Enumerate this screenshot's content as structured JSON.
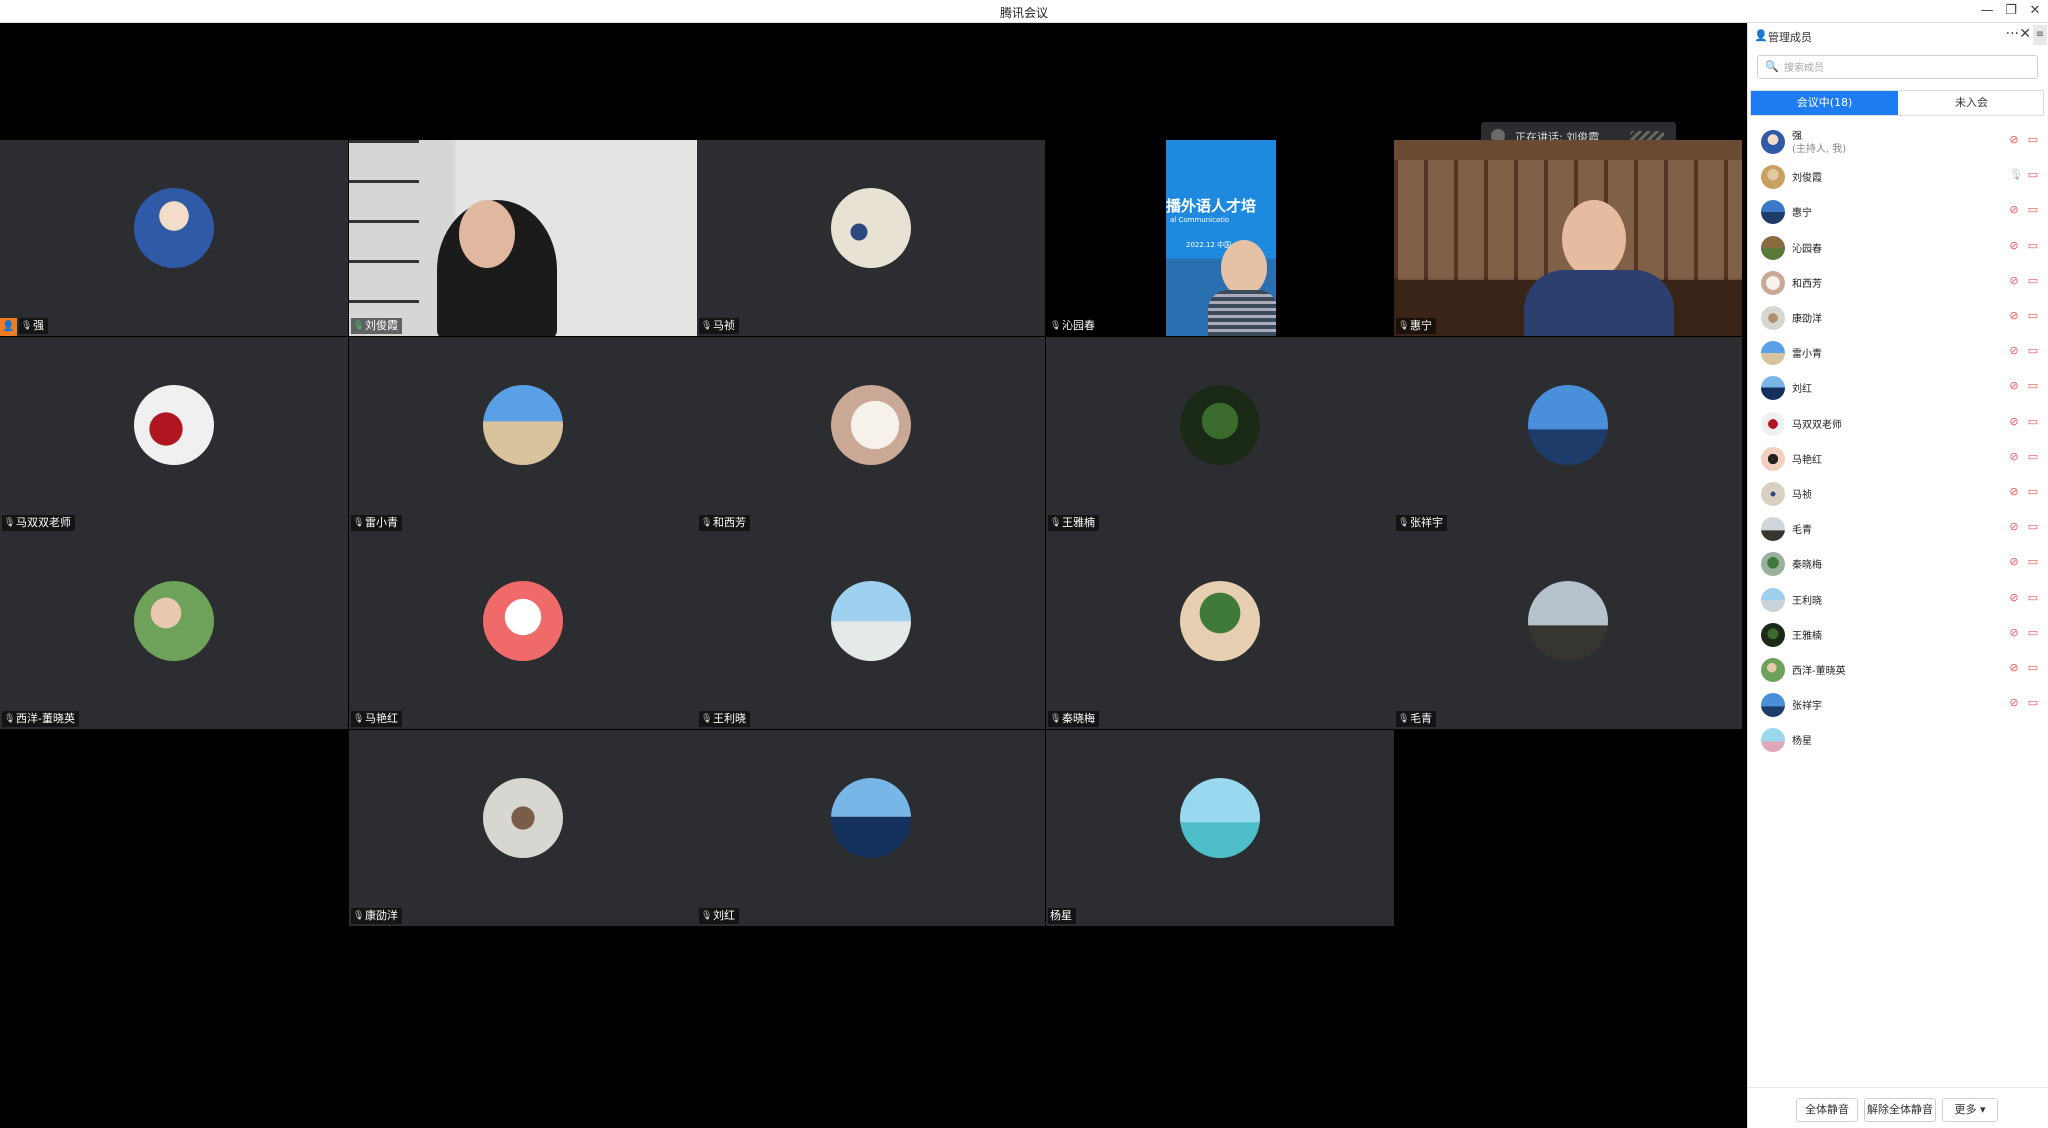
{
  "app": {
    "title": "腾讯会议"
  },
  "window": {
    "minimize": "—",
    "restore": "❐",
    "close": "✕"
  },
  "speaking": {
    "label": "正在讲话: 刘俊霞"
  },
  "colors": {
    "accent": "#1e7cf2",
    "tile_bg": "#2b2d31",
    "muted": "#e85656",
    "host_badge": "#f07c1f",
    "speaking_mic": "#3fc46b"
  },
  "tiles": [
    {
      "name": "强",
      "mic": "muted",
      "host": true
    },
    {
      "name": "刘俊霞",
      "mic": "on",
      "video": true
    },
    {
      "name": "马祯",
      "mic": "muted"
    },
    {
      "name": "沁园春",
      "mic": "muted",
      "video": true
    },
    {
      "name": "惠宁",
      "mic": "muted",
      "video": true
    },
    {
      "name": "马双双老师",
      "mic": "muted"
    },
    {
      "name": "雷小青",
      "mic": "muted"
    },
    {
      "name": "和西芳",
      "mic": "muted"
    },
    {
      "name": "王雅楠",
      "mic": "muted"
    },
    {
      "name": "张祥宇",
      "mic": "muted"
    },
    {
      "name": "西洋-董晓英",
      "mic": "muted"
    },
    {
      "name": "马艳红",
      "mic": "muted"
    },
    {
      "name": "王利晓",
      "mic": "muted"
    },
    {
      "name": "秦晓梅",
      "mic": "muted"
    },
    {
      "name": "毛青",
      "mic": "muted"
    },
    {
      "name": "康劭洋",
      "mic": "muted"
    },
    {
      "name": "刘红",
      "mic": "muted"
    },
    {
      "name": "杨星",
      "mic": "none"
    }
  ],
  "video_text": {
    "banner": "播外语人才培",
    "sub": "al Communicatio",
    "date": "2022.12  中国"
  },
  "panel": {
    "title": "管理成员",
    "more": "···",
    "close": "✕",
    "menu": "≡",
    "search_placeholder": "搜索成员",
    "tab_in": "会议中(18)",
    "tab_out": "未入会",
    "members": [
      {
        "name": "强",
        "sub": "(主持人, 我)"
      },
      {
        "name": "刘俊霞",
        "live": true
      },
      {
        "name": "惠宁"
      },
      {
        "name": "沁园春"
      },
      {
        "name": "和西芳"
      },
      {
        "name": "康劭洋"
      },
      {
        "name": "雷小青"
      },
      {
        "name": "刘红"
      },
      {
        "name": "马双双老师"
      },
      {
        "name": "马艳红"
      },
      {
        "name": "马祯"
      },
      {
        "name": "毛青"
      },
      {
        "name": "秦晓梅"
      },
      {
        "name": "王利晓"
      },
      {
        "name": "王雅楠"
      },
      {
        "name": "西洋-董晓英"
      },
      {
        "name": "张祥宇"
      },
      {
        "name": "杨星",
        "no_icons": true
      }
    ],
    "footer": {
      "mute_all": "全体静音",
      "unmute_all": "解除全体静音",
      "more": "更多 ▾"
    }
  },
  "icons": {
    "mic": "mic-icon",
    "mic_off": "mic-off-icon",
    "camera_off": "camera-off-icon",
    "search": "search-icon",
    "user": "user-icon"
  }
}
